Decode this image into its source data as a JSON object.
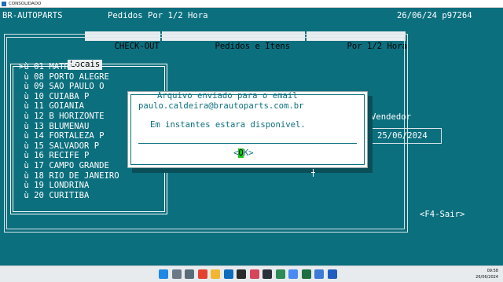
{
  "window": {
    "title": "CONSOLIDADO"
  },
  "header": {
    "app_name": "BR-AUTOPARTS",
    "report": "Pedidos Por 1/2 Hora",
    "date_user": "26/06/24 p97264"
  },
  "tabs": {
    "checkout": "CHECK-OUT",
    "pedidos_itens": "Pedidos e Itens",
    "por_meia_hora": "Por 1/2 Hora"
  },
  "locais": {
    "title": "Locais",
    "items": [
      {
        "prefix": ">ù",
        "code": "01",
        "name": "MATRIZ"
      },
      {
        "prefix": " ù",
        "code": "08",
        "name": "PORTO ALEGRE"
      },
      {
        "prefix": " ù",
        "code": "09",
        "name": "SAO PAULO O"
      },
      {
        "prefix": " ù",
        "code": "10",
        "name": "CUIABA P"
      },
      {
        "prefix": " ù",
        "code": "11",
        "name": "GOIANIA"
      },
      {
        "prefix": " ù",
        "code": "12",
        "name": "B HORIZONTE"
      },
      {
        "prefix": " ù",
        "code": "13",
        "name": "BLUMENAU"
      },
      {
        "prefix": " ù",
        "code": "14",
        "name": "FORTALEZA P"
      },
      {
        "prefix": " ù",
        "code": "15",
        "name": "SALVADOR P"
      },
      {
        "prefix": " ù",
        "code": "16",
        "name": "RECIFE P"
      },
      {
        "prefix": " ù",
        "code": "17",
        "name": "CAMPO GRANDE"
      },
      {
        "prefix": " ù",
        "code": "18",
        "name": "RIO DE JANEIRO"
      },
      {
        "prefix": " ù",
        "code": "19",
        "name": "LONDRINA"
      },
      {
        "prefix": " ù",
        "code": "20",
        "name": "CURITIBA"
      }
    ]
  },
  "right_panel": {
    "vendedor_label": "Vendedor",
    "date": "25/06/2024"
  },
  "footer": {
    "f4_label": "<F4-Sair>"
  },
  "dialog": {
    "line1": "Arquivo enviado para o email",
    "line2": "paulo.caldeira@brautoparts.com.br",
    "line3": "Em instantes estara disponivel.",
    "ok_left": "<",
    "ok_hl": "O",
    "ok_rest": "K>"
  },
  "taskbar": {
    "time": "09:58",
    "date": "26/06/2024",
    "icons": [
      {
        "name": "windows-start-icon",
        "color": "#1e88e5"
      },
      {
        "name": "search-icon",
        "color": "#6b7a86"
      },
      {
        "name": "task-view-icon",
        "color": "#5a6c7a"
      },
      {
        "name": "chrome-icon",
        "color": "#e4412f"
      },
      {
        "name": "file-explorer-icon",
        "color": "#f2b632"
      },
      {
        "name": "outlook-icon",
        "color": "#0f6cbd"
      },
      {
        "name": "terminal-app-icon",
        "color": "#2b2b2b"
      },
      {
        "name": "media-player-icon",
        "color": "#d6455a"
      },
      {
        "name": "teams-icon",
        "color": "#2b2f3a"
      },
      {
        "name": "shield-icon",
        "color": "#2e8b57"
      },
      {
        "name": "chrome-profile-icon",
        "color": "#4a8af4"
      },
      {
        "name": "excel-icon",
        "color": "#1d6f42"
      },
      {
        "name": "notes-icon",
        "color": "#3d7bd6"
      },
      {
        "name": "store-icon",
        "color": "#1f5fbf"
      }
    ]
  }
}
